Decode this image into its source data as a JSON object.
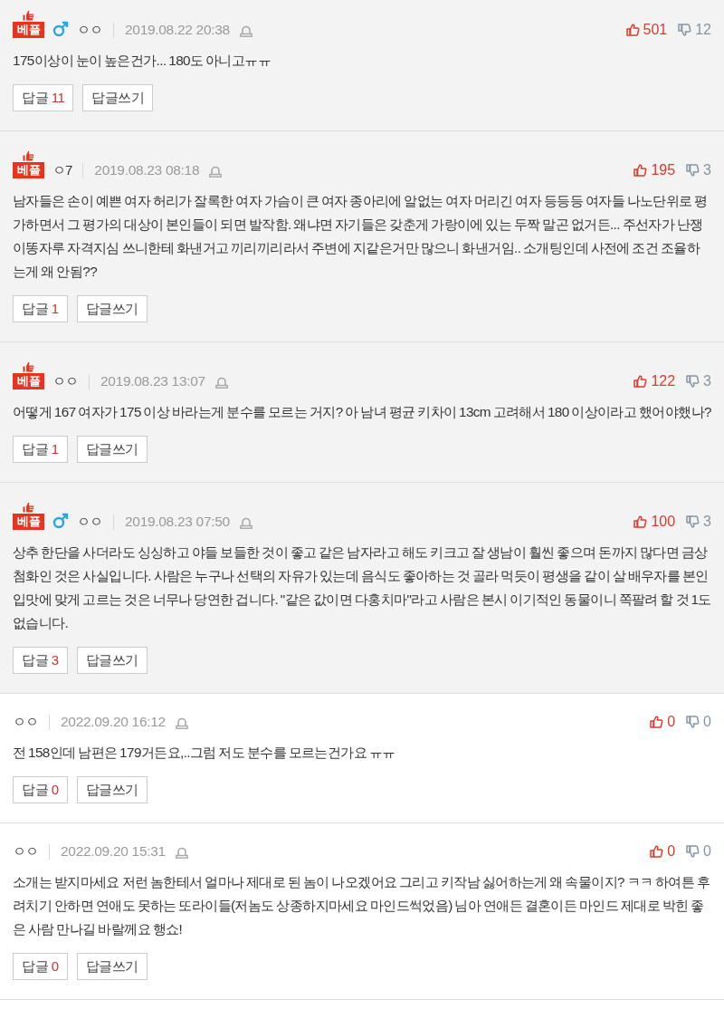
{
  "comments": [
    {
      "best": true,
      "badge": "베플",
      "male": true,
      "nickname": "ㅇㅇ",
      "date": "2019.08.22 20:38",
      "likes": "501",
      "dislikes": "12",
      "text": "175이상이 눈이 높은건가... 180도 아니고ㅠㅠ",
      "reply_label": "답글",
      "reply_count": "11",
      "write_label": "답글쓰기"
    },
    {
      "best": true,
      "badge": "베플",
      "male": false,
      "nickname": "ㅇ7",
      "date": "2019.08.23 08:18",
      "likes": "195",
      "dislikes": "3",
      "text": "남자들은 손이 예쁜 여자 허리가 잘록한 여자 가슴이 큰 여자 종아리에 알없는 여자 머리긴 여자 등등등 여자들 나노단위로 평가하면서 그 평가의 대상이 본인들이 되면 발작함. 왜냐면 자기들은 갖춘게 가랑이에 있는 두짝 말곤 없거든... 주선자가 난쟁이똥자루 자격지심 쓰니한테 화낸거고 끼리끼리라서 주변에 지같은거만 많으니 화낸거임.. 소개팅인데 사전에 조건 조율하는게 왜 안됨??",
      "reply_label": "답글",
      "reply_count": "1",
      "write_label": "답글쓰기"
    },
    {
      "best": true,
      "badge": "베플",
      "male": false,
      "nickname": "ㅇㅇ",
      "date": "2019.08.23 13:07",
      "likes": "122",
      "dislikes": "3",
      "text": "어떻게 167 여자가 175 이상 바라는게 분수를 모르는 거지? 아 남녀 평균 키차이 13cm 고려해서 180 이상이라고 했어야했나?",
      "reply_label": "답글",
      "reply_count": "1",
      "write_label": "답글쓰기"
    },
    {
      "best": true,
      "badge": "베플",
      "male": true,
      "nickname": "ㅇㅇ",
      "date": "2019.08.23 07:50",
      "likes": "100",
      "dislikes": "3",
      "text": "상추 한단을 사더라도 싱싱하고 야들 보들한 것이 좋고 같은 남자라고 해도 키크고 잘 생남이 훨씬 좋으며 돈까지 많다면 금상첨화인 것은 사실입니다. 사람은 누구나 선택의 자유가 있는데 음식도 좋아하는 것 골라 먹듯이 평생을 같이 살 배우자를 본인 입맛에 맞게 고르는 것은 너무나 당연한 겁니다. \"같은 값이면 다홍치마\"라고 사람은 본시 이기적인 동물이니 쪽팔려 할 것 1도 없습니다.",
      "reply_label": "답글",
      "reply_count": "3",
      "write_label": "답글쓰기"
    },
    {
      "best": false,
      "male": false,
      "nickname": "ㅇㅇ",
      "date": "2022.09.20 16:12",
      "likes": "0",
      "dislikes": "0",
      "text": "전 158인데 남편은 179거든요,..그럼 저도 분수를 모르는건가요 ㅠㅠ",
      "reply_label": "답글",
      "reply_count": "0",
      "write_label": "답글쓰기"
    },
    {
      "best": false,
      "male": false,
      "nickname": "ㅇㅇ",
      "date": "2022.09.20 15:31",
      "likes": "0",
      "dislikes": "0",
      "text": "소개는 받지마세요 저런 놈한테서 얼마나 제대로 된 놈이 나오겠어요 그리고 키작남 싫어하는게 왜 속물이지? ㅋㅋ 하여튼 후려치기 안하면 연애도 못하는 또라이들(저놈도 상종하지마세요 마인드썩었음) 님아 연애든 결혼이든 마인드 제대로 박힌 좋은 사람 만나길 바랄께요 행쇼!",
      "reply_label": "답글",
      "reply_count": "0",
      "write_label": "답글쓰기"
    }
  ]
}
